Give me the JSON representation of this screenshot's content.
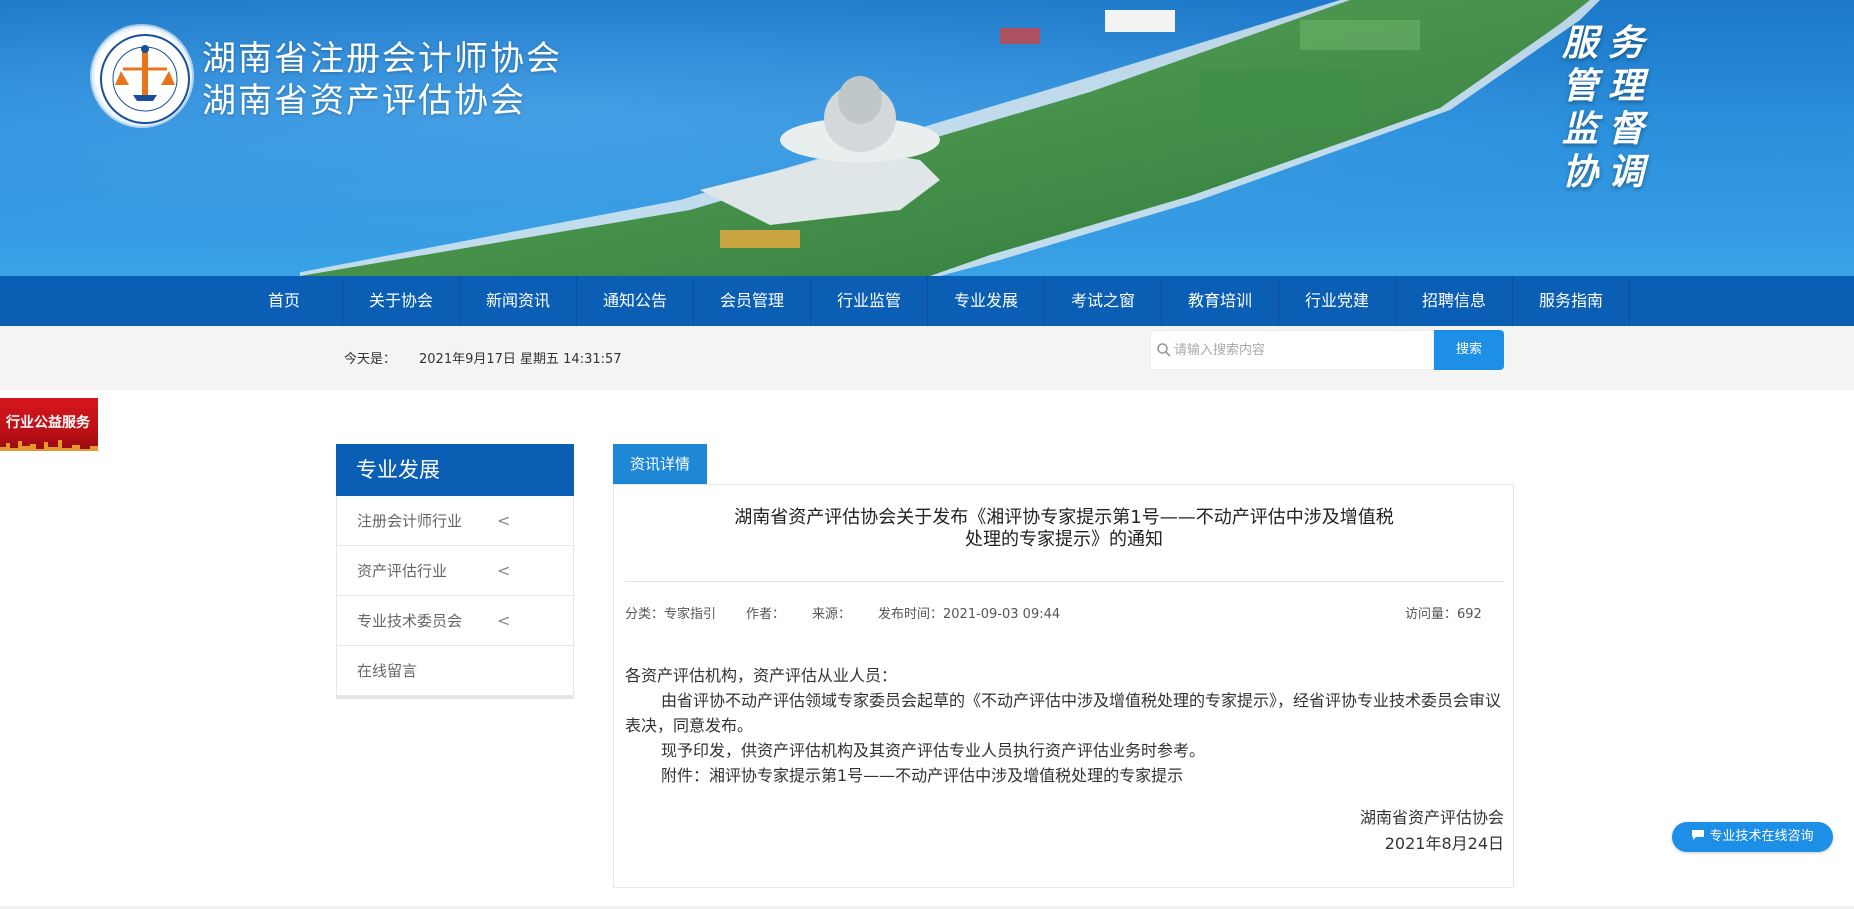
{
  "header": {
    "site_name_line1": "湖南省注册会计师协会",
    "site_name_line2": "湖南省资产评估协会",
    "logo_ring_text": "湖南省注册会计师协会",
    "slogan": [
      "服",
      "务",
      "管",
      "理",
      "监",
      "督",
      "协",
      "调"
    ]
  },
  "nav": {
    "items": [
      "首页",
      "关于协会",
      "新闻资讯",
      "通知公告",
      "会员管理",
      "行业监管",
      "专业发展",
      "考试之窗",
      "教育培训",
      "行业党建",
      "招聘信息",
      "服务指南"
    ]
  },
  "infobar": {
    "date_label": "今天是：",
    "date_value": "2021年9月17日 星期五 14:31:57",
    "search_placeholder": "请输入搜索内容",
    "search_button": "搜索"
  },
  "promo": {
    "label": "行业公益服务"
  },
  "sidebar": {
    "title": "专业发展",
    "items": [
      {
        "label": "注册会计师行业",
        "chevron": "<"
      },
      {
        "label": "资产评估行业",
        "chevron": "<"
      },
      {
        "label": "专业技术委员会",
        "chevron": "<"
      },
      {
        "label": "在线留言"
      }
    ]
  },
  "article": {
    "tab": "资讯详情",
    "title_line1": "湖南省资产评估协会关于发布《湘评协专家提示第1号——不动产评估中涉及增值税",
    "title_line2": "处理的专家提示》的通知",
    "meta": {
      "category": "分类：专家指引",
      "author": "作者：",
      "source": "来源：",
      "published": "发布时间：2021-09-03 09:44",
      "views": "访问量：692"
    },
    "body": {
      "salutation": "各资产评估机构，资产评估从业人员：",
      "para1": "由省评协不动产评估领域专家委员会起草的《不动产评估中涉及增值税处理的专家提示》，经省评协专业技术委员会审议表决，同意发布。",
      "para2": "现予印发，供资产评估机构及其资产评估专业人员执行资产评估业务时参考。",
      "para3": "附件：湘评协专家提示第1号——不动产评估中涉及增值税处理的专家提示"
    },
    "signature": {
      "org": "湖南省资产评估协会",
      "date": "2021年8月24日"
    }
  },
  "chat": {
    "label": "专业技术在线咨询"
  },
  "colors": {
    "nav_blue": "#0a5fb4",
    "accent_blue": "#1e8fe6",
    "promo_red": "#d7171e"
  }
}
